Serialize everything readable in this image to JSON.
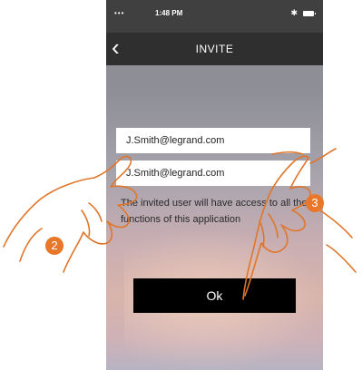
{
  "status_bar": {
    "signal": "•••",
    "time": "1:48 PM",
    "bluetooth": "✱"
  },
  "nav": {
    "back_icon": "‹",
    "title": "INVITE"
  },
  "form": {
    "email_value": "J.Smith@legrand.com",
    "email_confirm_value": "J.Smith@legrand.com",
    "note": "The invited user will have access to all the functions of this application",
    "ok_label": "Ok"
  },
  "steps": {
    "step_2": "2",
    "step_3": "3"
  },
  "colors": {
    "badge": "#e87729",
    "nav_bg": "#2f2f2f",
    "button_bg": "#000000"
  }
}
